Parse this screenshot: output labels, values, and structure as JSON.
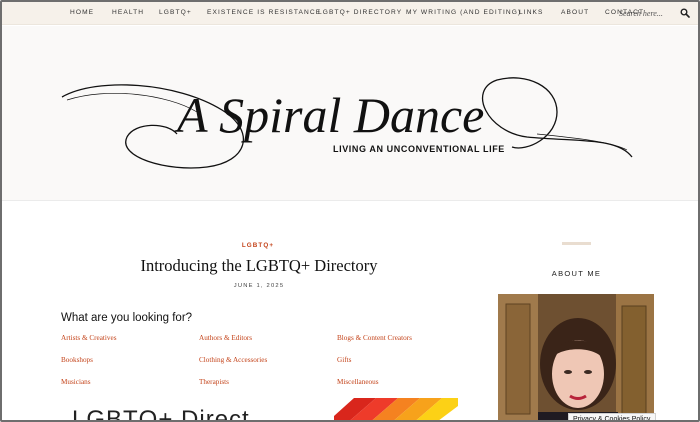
{
  "nav": {
    "items": [
      {
        "label": "HOME"
      },
      {
        "label": "HEALTH"
      },
      {
        "label": "LGBTQ+"
      },
      {
        "label": "EXISTENCE IS RESISTANCE"
      },
      {
        "label": "LGBTQ+ DIRECTORY"
      },
      {
        "label": "MY WRITING (AND EDITING)"
      },
      {
        "label": "LINKS"
      },
      {
        "label": "ABOUT"
      },
      {
        "label": "CONTACT"
      }
    ],
    "search_placeholder": "Search here...",
    "search_icon": "magnifier-icon"
  },
  "header": {
    "logo_text": "A Spiral Dance",
    "tagline": "LIVING AN UNCONVENTIONAL LIFE",
    "background_color": "#faf9f8"
  },
  "post": {
    "category": "LGBTQ+",
    "title": "Introducing the LGBTQ+ Directory",
    "date": "JUNE 1, 2025",
    "question": "What are you looking for?",
    "categories": [
      {
        "label": "Artists & Creatives"
      },
      {
        "label": "Authors & Editors"
      },
      {
        "label": "Blogs & Content Creators"
      },
      {
        "label": "Bookshops"
      },
      {
        "label": "Clothing & Accessories"
      },
      {
        "label": "Gifts"
      },
      {
        "label": "Musicians"
      },
      {
        "label": "Therapists"
      },
      {
        "label": "Miscellaneous"
      }
    ],
    "banner_text": "LGBTQ+ Direct",
    "accent_color": "#c4441b"
  },
  "sidebar": {
    "heading": "ABOUT ME"
  },
  "cookie": {
    "label": "Privacy & Cookies Policy"
  }
}
